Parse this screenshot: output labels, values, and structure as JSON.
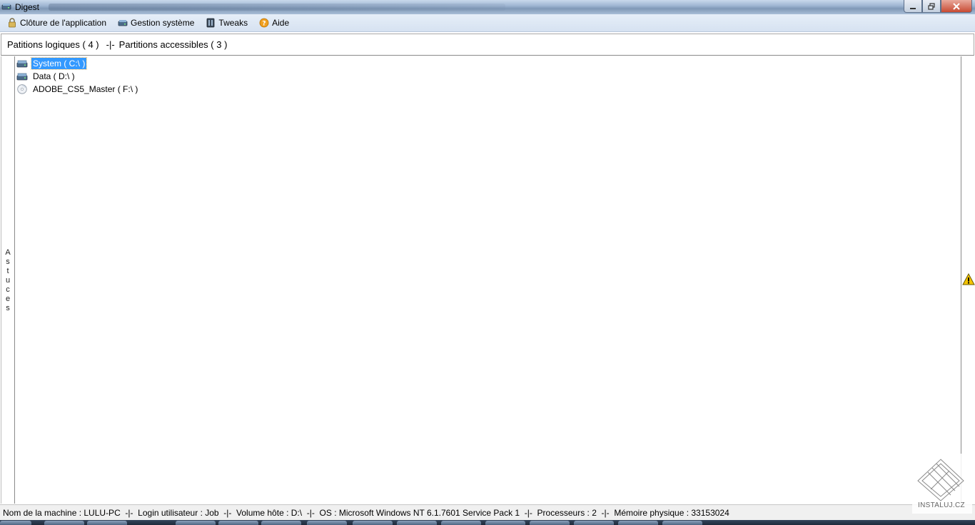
{
  "window": {
    "title": "Digest"
  },
  "menu": {
    "items": [
      {
        "label": "Clôture de l'application",
        "icon": "lock-icon"
      },
      {
        "label": "Gestion système",
        "icon": "drive-icon"
      },
      {
        "label": "Tweaks",
        "icon": "tweaks-icon"
      },
      {
        "label": "Aide",
        "icon": "help-icon"
      }
    ]
  },
  "tabs": {
    "logical": "Patitions logiques ( 4 )",
    "separator": "-|-",
    "accessible": "Partitions accessibles ( 3 )"
  },
  "tips": {
    "label_chars": [
      "A",
      "s",
      "t",
      "u",
      "c",
      "e",
      "s"
    ]
  },
  "tree": {
    "items": [
      {
        "label": "System ( C:\\ )",
        "icon": "hard-drive-icon",
        "selected": true
      },
      {
        "label": "Data ( D:\\ )",
        "icon": "hard-drive-icon",
        "selected": false
      },
      {
        "label": "ADOBE_CS5_Master ( F:\\ )",
        "icon": "cd-drive-icon",
        "selected": false
      }
    ]
  },
  "status": {
    "text": "Nom de la machine : LULU-PC  -|-  Login utilisateur : Job  -|-  Volume hôte : D:\\  -|-  OS : Microsoft Windows NT 6.1.7601 Service Pack 1  -|-  Processeurs : 2  -|-  Mémoire physique : 33153024"
  },
  "watermark": {
    "text": "INSTALUJ.CZ"
  },
  "colors": {
    "selection": "#3399ff",
    "titlebar": "#9fb6d2",
    "menubar": "#dfe8f4",
    "warning": "#f5c400"
  }
}
